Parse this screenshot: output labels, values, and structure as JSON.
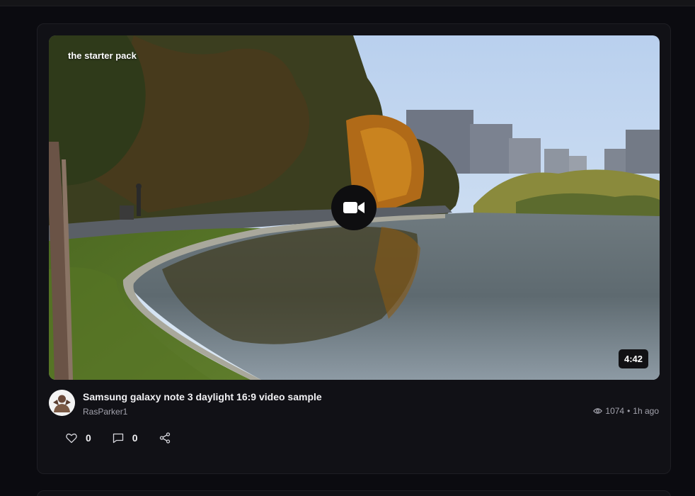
{
  "post": {
    "tag": "the starter pack",
    "duration": "4:42",
    "title": "Samsung galaxy note 3 daylight 16:9 video sample",
    "author": "RasParker1",
    "views": "1074",
    "separator": "•",
    "time_ago": "1h ago",
    "likes": "0",
    "comments": "0"
  },
  "icons": {
    "play": "video-camera-icon",
    "views": "eye-icon",
    "like": "heart-icon",
    "comment": "comment-icon",
    "share": "share-icon"
  },
  "colors": {
    "background": "#0b0b10",
    "card": "#111116",
    "muted_text": "#a3a3ad"
  }
}
